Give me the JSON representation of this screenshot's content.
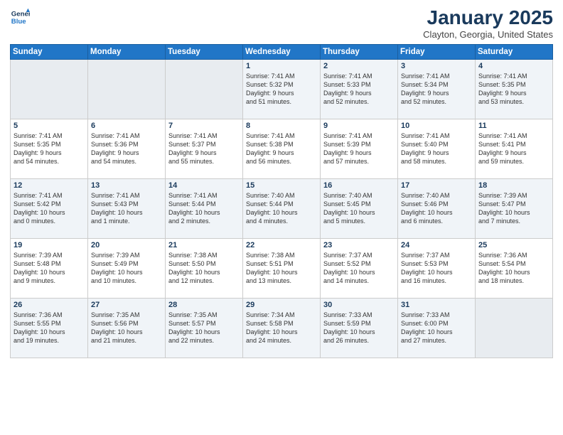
{
  "header": {
    "logo_line1": "General",
    "logo_line2": "Blue",
    "month": "January 2025",
    "location": "Clayton, Georgia, United States"
  },
  "weekdays": [
    "Sunday",
    "Monday",
    "Tuesday",
    "Wednesday",
    "Thursday",
    "Friday",
    "Saturday"
  ],
  "weeks": [
    [
      {
        "day": "",
        "text": ""
      },
      {
        "day": "",
        "text": ""
      },
      {
        "day": "",
        "text": ""
      },
      {
        "day": "1",
        "text": "Sunrise: 7:41 AM\nSunset: 5:32 PM\nDaylight: 9 hours\nand 51 minutes."
      },
      {
        "day": "2",
        "text": "Sunrise: 7:41 AM\nSunset: 5:33 PM\nDaylight: 9 hours\nand 52 minutes."
      },
      {
        "day": "3",
        "text": "Sunrise: 7:41 AM\nSunset: 5:34 PM\nDaylight: 9 hours\nand 52 minutes."
      },
      {
        "day": "4",
        "text": "Sunrise: 7:41 AM\nSunset: 5:35 PM\nDaylight: 9 hours\nand 53 minutes."
      }
    ],
    [
      {
        "day": "5",
        "text": "Sunrise: 7:41 AM\nSunset: 5:35 PM\nDaylight: 9 hours\nand 54 minutes."
      },
      {
        "day": "6",
        "text": "Sunrise: 7:41 AM\nSunset: 5:36 PM\nDaylight: 9 hours\nand 54 minutes."
      },
      {
        "day": "7",
        "text": "Sunrise: 7:41 AM\nSunset: 5:37 PM\nDaylight: 9 hours\nand 55 minutes."
      },
      {
        "day": "8",
        "text": "Sunrise: 7:41 AM\nSunset: 5:38 PM\nDaylight: 9 hours\nand 56 minutes."
      },
      {
        "day": "9",
        "text": "Sunrise: 7:41 AM\nSunset: 5:39 PM\nDaylight: 9 hours\nand 57 minutes."
      },
      {
        "day": "10",
        "text": "Sunrise: 7:41 AM\nSunset: 5:40 PM\nDaylight: 9 hours\nand 58 minutes."
      },
      {
        "day": "11",
        "text": "Sunrise: 7:41 AM\nSunset: 5:41 PM\nDaylight: 9 hours\nand 59 minutes."
      }
    ],
    [
      {
        "day": "12",
        "text": "Sunrise: 7:41 AM\nSunset: 5:42 PM\nDaylight: 10 hours\nand 0 minutes."
      },
      {
        "day": "13",
        "text": "Sunrise: 7:41 AM\nSunset: 5:43 PM\nDaylight: 10 hours\nand 1 minute."
      },
      {
        "day": "14",
        "text": "Sunrise: 7:41 AM\nSunset: 5:44 PM\nDaylight: 10 hours\nand 2 minutes."
      },
      {
        "day": "15",
        "text": "Sunrise: 7:40 AM\nSunset: 5:44 PM\nDaylight: 10 hours\nand 4 minutes."
      },
      {
        "day": "16",
        "text": "Sunrise: 7:40 AM\nSunset: 5:45 PM\nDaylight: 10 hours\nand 5 minutes."
      },
      {
        "day": "17",
        "text": "Sunrise: 7:40 AM\nSunset: 5:46 PM\nDaylight: 10 hours\nand 6 minutes."
      },
      {
        "day": "18",
        "text": "Sunrise: 7:39 AM\nSunset: 5:47 PM\nDaylight: 10 hours\nand 7 minutes."
      }
    ],
    [
      {
        "day": "19",
        "text": "Sunrise: 7:39 AM\nSunset: 5:48 PM\nDaylight: 10 hours\nand 9 minutes."
      },
      {
        "day": "20",
        "text": "Sunrise: 7:39 AM\nSunset: 5:49 PM\nDaylight: 10 hours\nand 10 minutes."
      },
      {
        "day": "21",
        "text": "Sunrise: 7:38 AM\nSunset: 5:50 PM\nDaylight: 10 hours\nand 12 minutes."
      },
      {
        "day": "22",
        "text": "Sunrise: 7:38 AM\nSunset: 5:51 PM\nDaylight: 10 hours\nand 13 minutes."
      },
      {
        "day": "23",
        "text": "Sunrise: 7:37 AM\nSunset: 5:52 PM\nDaylight: 10 hours\nand 14 minutes."
      },
      {
        "day": "24",
        "text": "Sunrise: 7:37 AM\nSunset: 5:53 PM\nDaylight: 10 hours\nand 16 minutes."
      },
      {
        "day": "25",
        "text": "Sunrise: 7:36 AM\nSunset: 5:54 PM\nDaylight: 10 hours\nand 18 minutes."
      }
    ],
    [
      {
        "day": "26",
        "text": "Sunrise: 7:36 AM\nSunset: 5:55 PM\nDaylight: 10 hours\nand 19 minutes."
      },
      {
        "day": "27",
        "text": "Sunrise: 7:35 AM\nSunset: 5:56 PM\nDaylight: 10 hours\nand 21 minutes."
      },
      {
        "day": "28",
        "text": "Sunrise: 7:35 AM\nSunset: 5:57 PM\nDaylight: 10 hours\nand 22 minutes."
      },
      {
        "day": "29",
        "text": "Sunrise: 7:34 AM\nSunset: 5:58 PM\nDaylight: 10 hours\nand 24 minutes."
      },
      {
        "day": "30",
        "text": "Sunrise: 7:33 AM\nSunset: 5:59 PM\nDaylight: 10 hours\nand 26 minutes."
      },
      {
        "day": "31",
        "text": "Sunrise: 7:33 AM\nSunset: 6:00 PM\nDaylight: 10 hours\nand 27 minutes."
      },
      {
        "day": "",
        "text": ""
      }
    ]
  ]
}
